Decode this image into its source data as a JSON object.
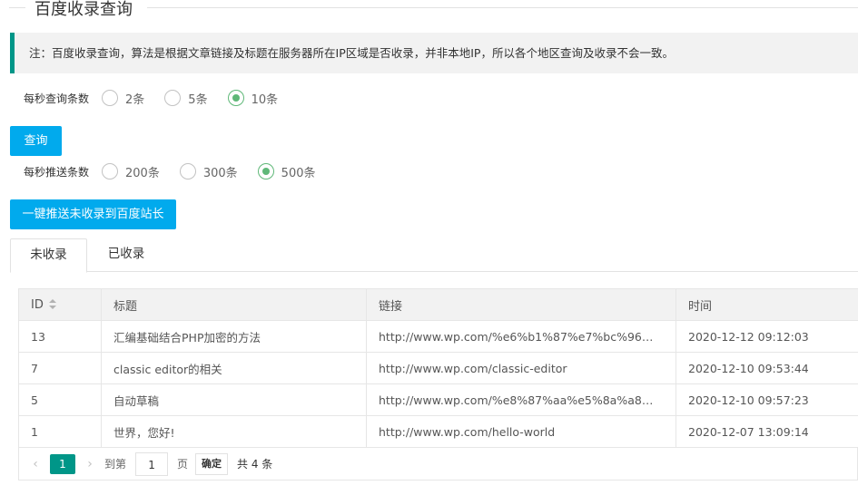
{
  "title": "百度收录查询",
  "notice": "注：百度收录查询，算法是根据文章链接及标题在服务器所在IP区域是否收录，并非本地IP，所以各个地区查询及收录不会一致。",
  "query_rate": {
    "label": "每秒查询条数",
    "options": [
      "2条",
      "5条",
      "10条"
    ],
    "selected": "10条"
  },
  "query_button": "查询",
  "push_rate": {
    "label": "每秒推送条数",
    "options": [
      "200条",
      "300条",
      "500条"
    ],
    "selected": "500条"
  },
  "push_button": "一键推送未收录到百度站长",
  "tabs": [
    "未收录",
    "已收录"
  ],
  "active_tab": "未收录",
  "table": {
    "headers": [
      "ID",
      "标题",
      "链接",
      "时间"
    ],
    "rows": [
      [
        "13",
        "汇编基础结合PHP加密的方法",
        "http://www.wp.com/%e6%b1%87%e7%bc%96%e5%9f%ba%e7%a1%80",
        "2020-12-12 09:12:03"
      ],
      [
        "7",
        "classic editor的相关",
        "http://www.wp.com/classic-editor",
        "2020-12-10 09:53:44"
      ],
      [
        "5",
        "自动草稿",
        "http://www.wp.com/%e8%87%aa%e5%8a%a8%e8%8d%89%e7%a8%bf",
        "2020-12-10 09:57:23"
      ],
      [
        "1",
        "世界，您好!",
        "http://www.wp.com/hello-world",
        "2020-12-07 13:09:14"
      ]
    ]
  },
  "pager": {
    "prev": "‹",
    "current": "1",
    "next": "›",
    "goto_label": "到第",
    "goto_value": "1",
    "page_label": "页",
    "confirm": "确定",
    "total": "共 4 条"
  },
  "colors": {
    "accent_button": "#01AAED",
    "notice_border": "#009688",
    "radio_checked": "#5FB878",
    "pager_current": "#009688"
  }
}
